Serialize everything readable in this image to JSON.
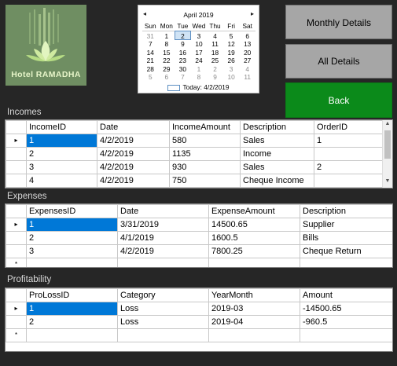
{
  "logo": {
    "text": "Hotel RAMADHA"
  },
  "calendar": {
    "prev_icon": "◂",
    "next_icon": "▸",
    "month_title": "April 2019",
    "weekdays": [
      "Sun",
      "Mon",
      "Tue",
      "Wed",
      "Thu",
      "Fri",
      "Sat"
    ],
    "weeks": [
      [
        "31",
        "1",
        "2",
        "3",
        "4",
        "5",
        "6"
      ],
      [
        "7",
        "8",
        "9",
        "10",
        "11",
        "12",
        "13"
      ],
      [
        "14",
        "15",
        "16",
        "17",
        "18",
        "19",
        "20"
      ],
      [
        "21",
        "22",
        "23",
        "24",
        "25",
        "26",
        "27"
      ],
      [
        "28",
        "29",
        "30",
        "1",
        "2",
        "3",
        "4"
      ],
      [
        "5",
        "6",
        "7",
        "8",
        "9",
        "10",
        "11"
      ]
    ],
    "today_text": "Today: 4/2/2019"
  },
  "buttons": {
    "monthly": "Monthly Details",
    "all": "All Details",
    "back": "Back"
  },
  "incomes": {
    "label": "Incomes",
    "columns": [
      "IncomeID",
      "Date",
      "IncomeAmount",
      "Description",
      "OrderID"
    ],
    "rows": [
      [
        "1",
        "4/2/2019",
        "580",
        "Sales",
        "1"
      ],
      [
        "2",
        "4/2/2019",
        "1135",
        "Income",
        ""
      ],
      [
        "3",
        "4/2/2019",
        "930",
        "Sales",
        "2"
      ],
      [
        "4",
        "4/2/2019",
        "750",
        "Cheque Income",
        ""
      ]
    ]
  },
  "expenses": {
    "label": "Expenses",
    "columns": [
      "ExpensesID",
      "Date",
      "ExpenseAmount",
      "Description"
    ],
    "rows": [
      [
        "1",
        "3/31/2019",
        "14500.65",
        "Supplier"
      ],
      [
        "2",
        "4/1/2019",
        "1600.5",
        "Bills"
      ],
      [
        "3",
        "4/2/2019",
        "7800.25",
        "Cheque Return"
      ]
    ]
  },
  "profitability": {
    "label": "Profitability",
    "columns": [
      "ProLossID",
      "Category",
      "YearMonth",
      "Amount"
    ],
    "rows": [
      [
        "1",
        "Loss",
        "2019-03",
        "-14500.65"
      ],
      [
        "2",
        "Loss",
        "2019-04",
        "-960.5"
      ]
    ]
  },
  "grid_markers": {
    "current_row": "▸",
    "new_row": "*"
  },
  "colors": {
    "background": "#262626",
    "back_button": "#0b8a1a",
    "selection": "#0078d7"
  }
}
